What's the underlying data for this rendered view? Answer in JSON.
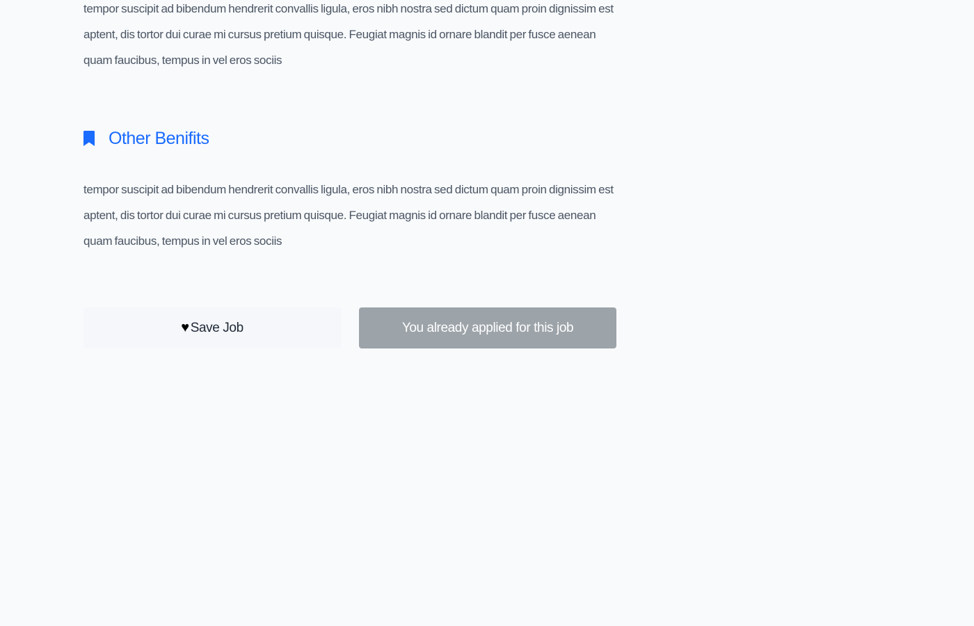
{
  "sections": [
    {
      "body": "tempor suscipit ad bibendum hendrerit convallis ligula, eros nibh nostra sed dictum quam proin dignissim est aptent, dis tortor dui curae mi cursus pretium quisque. Feugiat magnis id ornare blandit per fusce aenean quam faucibus, tempus in vel eros sociis"
    },
    {
      "heading": "Other Benifits",
      "icon": "bookmark-icon",
      "body": "tempor suscipit ad bibendum hendrerit convallis ligula, eros nibh nostra sed dictum quam proin dignissim est aptent, dis tortor dui curae mi cursus pretium quisque. Feugiat magnis id ornare blandit per fusce aenean quam faucibus, tempus in vel eros sociis"
    }
  ],
  "actions": {
    "save_label": "Save Job",
    "save_icon": "heart-icon",
    "applied_label": "You already applied for this job"
  },
  "colors": {
    "accent": "#1a6bff",
    "body_text": "#4b5563",
    "applied_button_bg": "#9ca3a9",
    "page_bg": "#f8fafc"
  }
}
